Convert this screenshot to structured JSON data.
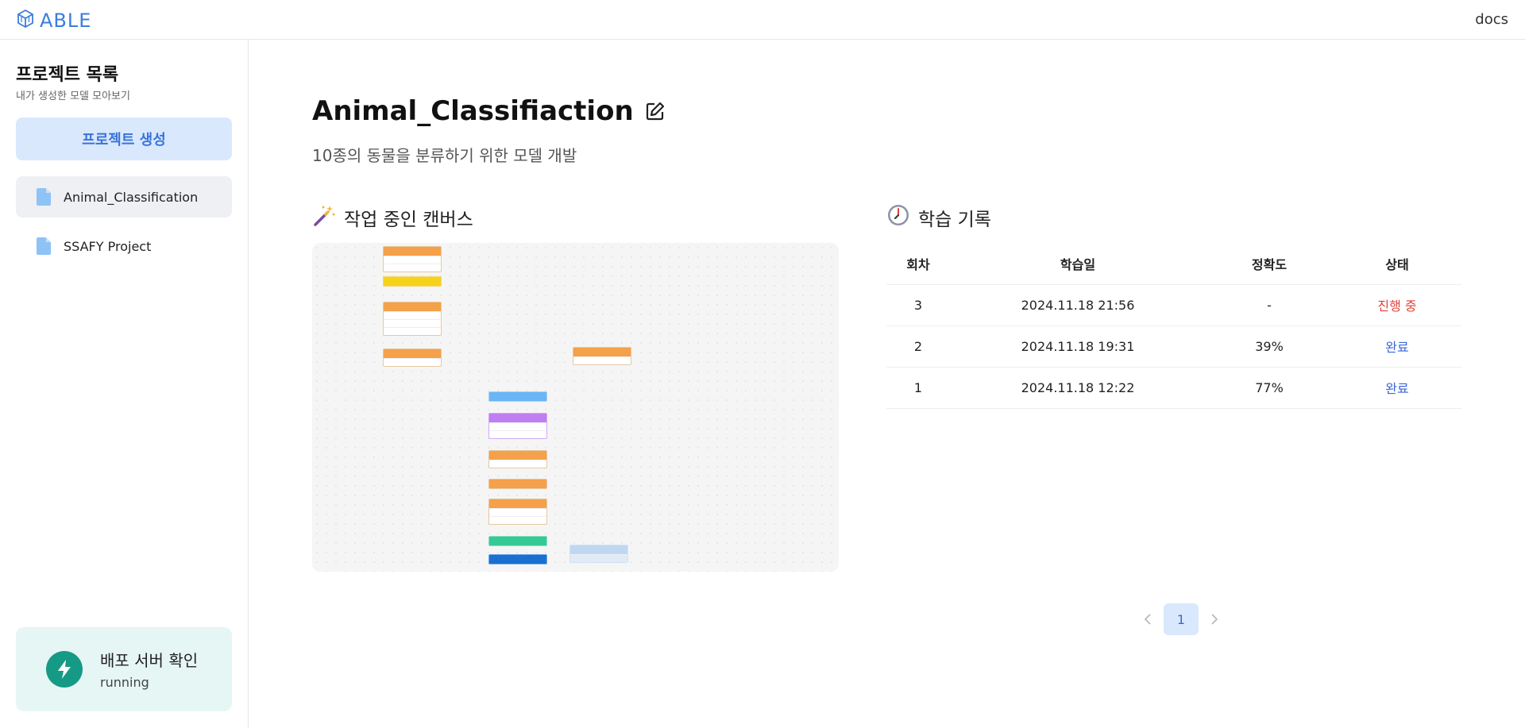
{
  "header": {
    "logo_text": "ABLE",
    "docs_label": "docs"
  },
  "sidebar": {
    "title": "프로젝트 목록",
    "subtitle": "내가 생성한 모델 모아보기",
    "create_label": "프로젝트 생성",
    "projects": [
      {
        "label": "Animal_Classification",
        "active": true
      },
      {
        "label": "SSAFY Project",
        "active": false
      }
    ],
    "deploy": {
      "title": "배포 서버 확인",
      "status": "running"
    }
  },
  "main": {
    "title": "Animal_Classifiaction",
    "description": "10종의 동물을 분류하기 위한 모델 개발",
    "canvas_section": {
      "title": "작업 중인 캔버스",
      "icon": "magic-wand-icon"
    },
    "history_section": {
      "title": "학습 기록",
      "icon": "clock-icon"
    },
    "table": {
      "headers": [
        "회차",
        "학습일",
        "정확도",
        "상태"
      ],
      "rows": [
        {
          "round": "3",
          "date": "2024.11.18 21:56",
          "accuracy": "-",
          "status": "진행 중",
          "status_color": "#e0413a"
        },
        {
          "round": "2",
          "date": "2024.11.18 19:31",
          "accuracy": "39%",
          "status": "완료",
          "status_color": "#3a66d9"
        },
        {
          "round": "1",
          "date": "2024.11.18 12:22",
          "accuracy": "77%",
          "status": "완료",
          "status_color": "#3a66d9"
        }
      ]
    },
    "pagination": {
      "current": "1"
    }
  },
  "colors": {
    "accent": "#3a73d9",
    "running": "#e0413a",
    "done": "#3a66d9",
    "deploy_icon": "#159a86"
  }
}
